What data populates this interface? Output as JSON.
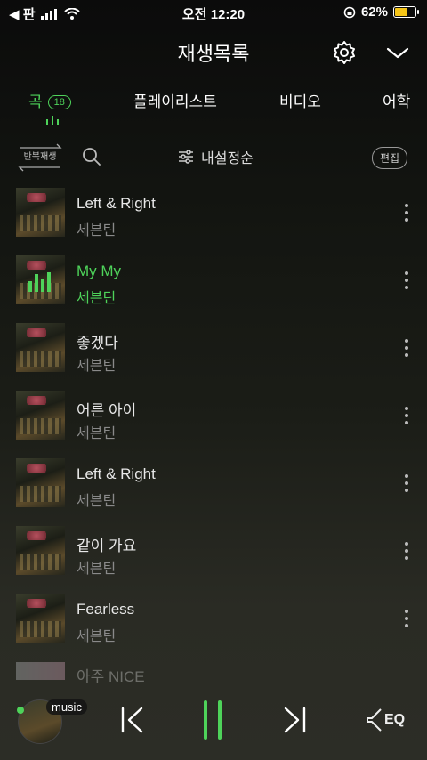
{
  "status_bar": {
    "carrier_back": "◀ 판",
    "time": "오전 12:20",
    "battery_percent": "62%",
    "battery_level": 0.62
  },
  "header": {
    "title": "재생목록"
  },
  "tabs": [
    {
      "label": "곡",
      "badge": "18",
      "active": true
    },
    {
      "label": "플레이리스트"
    },
    {
      "label": "비디오"
    },
    {
      "label": "어학"
    }
  ],
  "toolbar": {
    "repeat_label": "반복재생",
    "sort_label": "내설정순",
    "edit_label": "편집"
  },
  "songs": [
    {
      "title": "Left & Right",
      "artist": "세븐틴"
    },
    {
      "title": "My My",
      "artist": "세븐틴",
      "playing": true
    },
    {
      "title": "좋겠다",
      "artist": "세븐틴"
    },
    {
      "title": "어른 아이",
      "artist": "세븐틴"
    },
    {
      "title": "Left & Right",
      "artist": "세븐틴"
    },
    {
      "title": "같이 가요",
      "artist": "세븐틴"
    },
    {
      "title": "Fearless",
      "artist": "세븐틴"
    },
    {
      "title": "아주 NICE",
      "artist": ""
    }
  ],
  "player": {
    "tag": "music"
  },
  "colors": {
    "accent": "#4ed35a",
    "battery": "#f5c518"
  }
}
